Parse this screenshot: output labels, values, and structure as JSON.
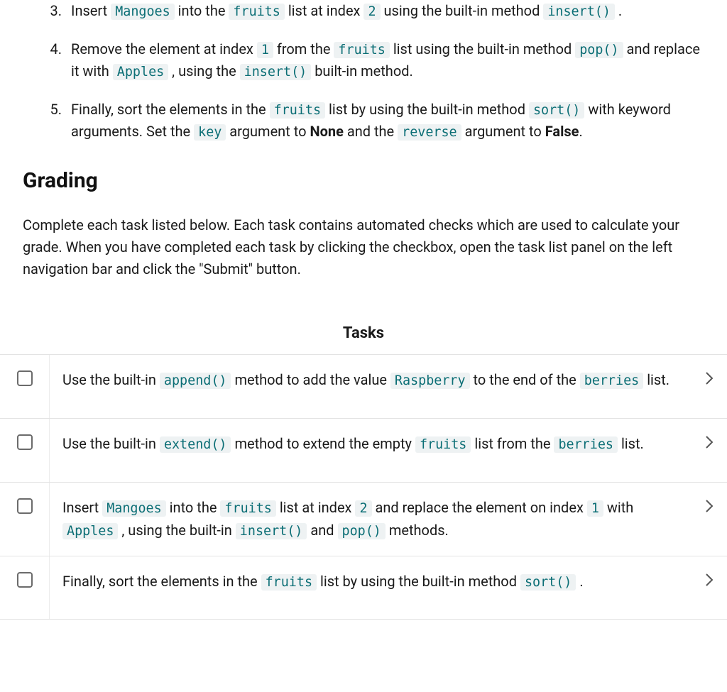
{
  "instructions": {
    "item3": {
      "t0": "Insert ",
      "c0": "Mangoes",
      "t1": " into the ",
      "c1": "fruits",
      "t2": " list at index ",
      "c2": "2",
      "t3": " using the built-in method ",
      "c3": "insert()",
      "t4": " ."
    },
    "item4": {
      "t0": "Remove the element at index ",
      "c0": "1",
      "t1": " from the ",
      "c1": "fruits",
      "t2": " list using the built-in method ",
      "c2": "pop()",
      "t3": " and replace it with ",
      "c3": "Apples",
      "t4": " , using the ",
      "c4": "insert()",
      "t5": " built-in method."
    },
    "item5": {
      "t0": "Finally, sort the elements in the ",
      "c0": "fruits",
      "t1": " list by using the built-in method ",
      "c1": "sort()",
      "t2": " with keyword arguments. Set the ",
      "c2": "key",
      "t3": " argument to ",
      "b0": "None",
      "t4": " and the ",
      "c3": "reverse",
      "t5": " argument to ",
      "b1": "False",
      "t6": "."
    }
  },
  "grading": {
    "heading": "Grading",
    "desc": "Complete each task listed below. Each task contains automated checks which are used to calculate your grade. When you have completed each task by clicking the checkbox, open the task list panel on the left navigation bar and click the \"Submit\" button."
  },
  "tasks": {
    "header": "Tasks",
    "task1": {
      "t0": "Use the built-in ",
      "c0": "append()",
      "t1": " method to add the value ",
      "c1": "Raspberry",
      "t2": " to the end of the ",
      "c2": "berries",
      "t3": " list."
    },
    "task2": {
      "t0": "Use the built-in ",
      "c0": "extend()",
      "t1": " method to extend the empty ",
      "c1": "fruits",
      "t2": " list from the ",
      "c2": "berries",
      "t3": " list."
    },
    "task3": {
      "t0": "Insert ",
      "c0": "Mangoes",
      "t1": " into the ",
      "c1": "fruits",
      "t2": " list at index ",
      "c2": "2",
      "t3": " and replace the element on index ",
      "c3": "1",
      "t4": " with ",
      "c4": "Apples",
      "t5": " , using the built-in ",
      "c5": "insert()",
      "t6": " and ",
      "c6": "pop()",
      "t7": " methods."
    },
    "task4": {
      "t0": "Finally, sort the elements in the ",
      "c0": "fruits",
      "t1": " list by using the built-in method ",
      "c1": "sort()",
      "t2": " ."
    }
  }
}
